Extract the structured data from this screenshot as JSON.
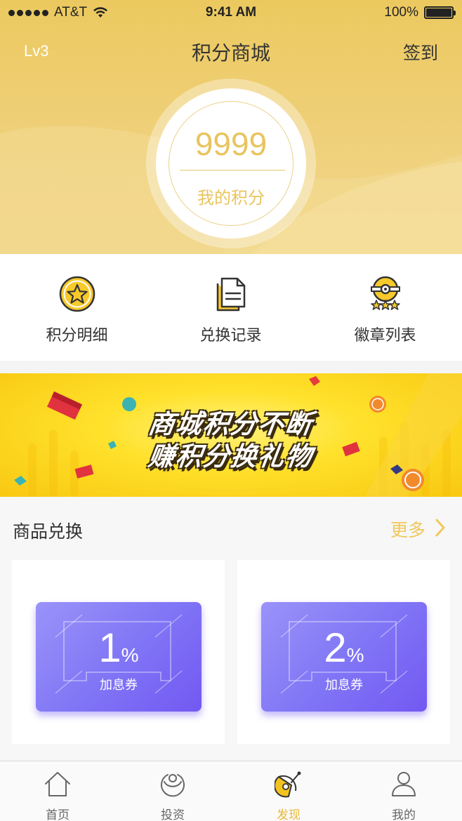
{
  "status_bar": {
    "carrier": "AT&T",
    "time": "9:41 AM",
    "battery": "100%"
  },
  "nav": {
    "level": "Lv3",
    "title": "积分商城",
    "sign_in": "签到"
  },
  "points": {
    "value": "9999",
    "label": "我的积分"
  },
  "quick_menu": [
    {
      "label": "积分明细",
      "icon": "star-badge-icon"
    },
    {
      "label": "兑换记录",
      "icon": "document-icon"
    },
    {
      "label": "徽章列表",
      "icon": "medal-icon"
    }
  ],
  "banner": {
    "line1": "商城积分不断",
    "line2": "赚积分换礼物"
  },
  "products": {
    "title": "商品兑换",
    "more": "更多",
    "items": [
      {
        "value": "1",
        "unit": "%",
        "name": "加息券"
      },
      {
        "value": "2",
        "unit": "%",
        "name": "加息券"
      }
    ]
  },
  "tabbar": {
    "active": "发现",
    "items": [
      {
        "label": "首页",
        "icon": "home-icon"
      },
      {
        "label": "投资",
        "icon": "invest-icon"
      },
      {
        "label": "发现",
        "icon": "discover-icon"
      },
      {
        "label": "我的",
        "icon": "user-icon"
      }
    ]
  },
  "colors": {
    "gold": "#ecc95f",
    "accent": "#e9c45e",
    "coupon": "#7a66f4",
    "banner": "#ffe12b"
  }
}
